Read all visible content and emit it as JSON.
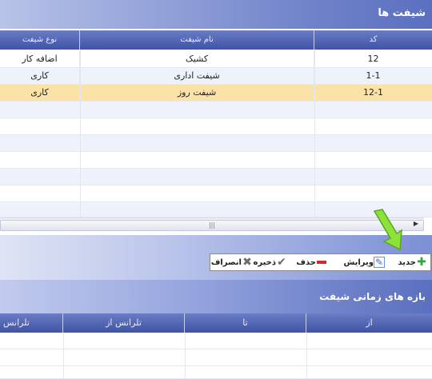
{
  "shifts_panel": {
    "title": "شیفت ها",
    "columns": {
      "code": "کد",
      "name": "نام شیفت",
      "type": "نوع شیفت"
    },
    "rows": [
      {
        "code": "12",
        "name": "کشیک",
        "type": "اضافه کار"
      },
      {
        "code": "1-1",
        "name": "شیفت اداری",
        "type": "کاری"
      },
      {
        "code": "12-1",
        "name": "شیفت روز",
        "type": "کاری"
      }
    ],
    "scroll_grip": "|||",
    "scroll_arrow": "▶"
  },
  "toolbar": {
    "new_label": "جدید",
    "edit_label": "ویرایش",
    "delete_label": "حذف",
    "save_label": "ذخیره",
    "cancel_label": "انصراف"
  },
  "intervals_panel": {
    "title": "بازه های زمانی شیفت",
    "columns": {
      "from": "از",
      "to": "تا",
      "tolerance_from": "تلرانس از",
      "tolerance_to": "تلرانس"
    }
  },
  "colors": {
    "selected_row": "#fbe3a8",
    "alt_row": "#eef2fa",
    "arrow": "#8ee03a"
  }
}
